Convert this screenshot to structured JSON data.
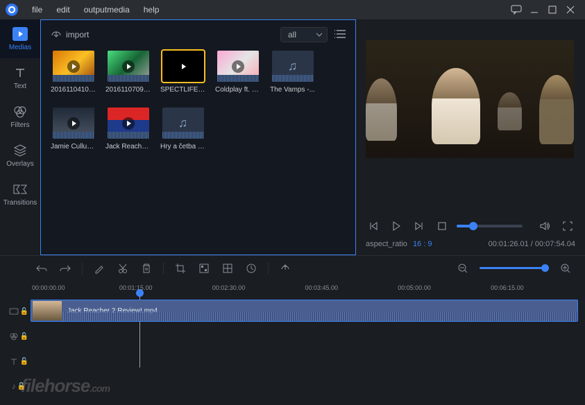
{
  "menu": {
    "file": "file",
    "edit": "edit",
    "outputmedia": "outputmedia",
    "help": "help"
  },
  "vtabs": {
    "medias": "Medias",
    "text": "Text",
    "filters": "Filters",
    "overlays": "Overlays",
    "transitions": "Transitions"
  },
  "media": {
    "import": "import",
    "filter_all": "all",
    "items": [
      {
        "label": "20161104100..."
      },
      {
        "label": "20161107092..."
      },
      {
        "label": "SPECTLIFE m..."
      },
      {
        "label": "Coldplay ft. C..."
      },
      {
        "label": "The Vamps -..."
      },
      {
        "label": "Jamie Cullum..."
      },
      {
        "label": "Jack Reacher..."
      },
      {
        "label": "Hry a četba (..."
      }
    ]
  },
  "preview": {
    "aspect_label": "aspect_ratio",
    "aspect_value": "16 : 9",
    "time": "00:01:26.01 / 00:07:54.04"
  },
  "timeline": {
    "ticks": [
      "00:00:00.00",
      "00:01:15.00",
      "00:02:30.00",
      "00:03:45.00",
      "00:05:00.00",
      "00:06:15.00"
    ],
    "clip_label": "Jack Reacher 2 Review!.mp4"
  },
  "watermark": {
    "main": "filehorse",
    "suffix": ".com"
  }
}
